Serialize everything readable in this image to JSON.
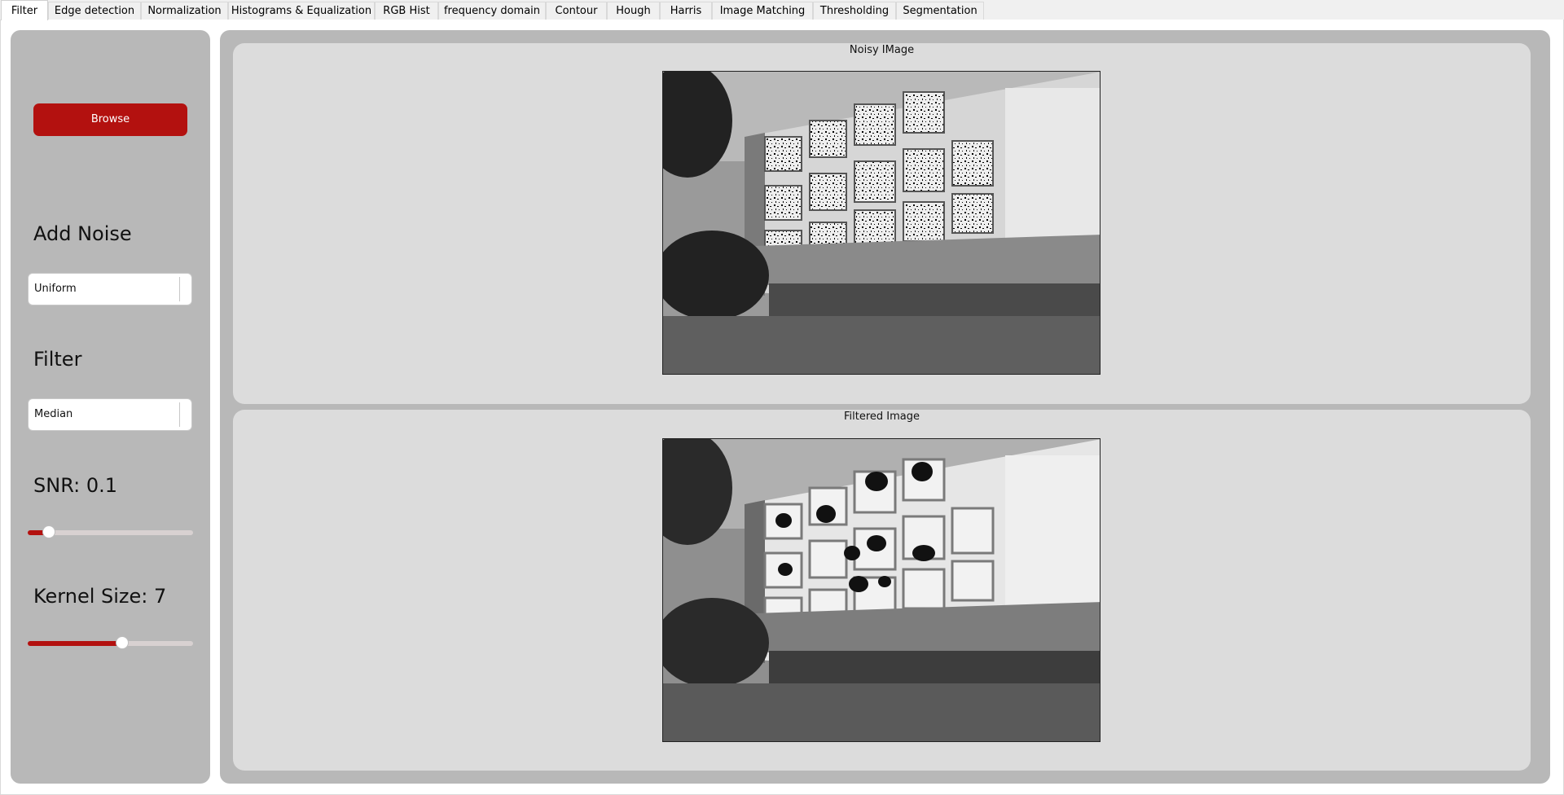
{
  "tabs": [
    {
      "label": "Filter",
      "active": true
    },
    {
      "label": "Edge detection"
    },
    {
      "label": "Normalization"
    },
    {
      "label": "Histograms & Equalization"
    },
    {
      "label": "RGB Hist"
    },
    {
      "label": "frequency domain"
    },
    {
      "label": "Contour"
    },
    {
      "label": "Hough"
    },
    {
      "label": "Harris"
    },
    {
      "label": "Image Matching"
    },
    {
      "label": "Thresholding"
    },
    {
      "label": "Segmentation"
    }
  ],
  "sidebar": {
    "browse_label": "Browse",
    "noise_title": "Add Noise",
    "noise_value": "Uniform",
    "filter_title": "Filter",
    "filter_value": "Median",
    "snr_label": "SNR: 0.1",
    "snr_fraction": 0.13,
    "kernel_label": "Kernel Size: 7",
    "kernel_fraction": 0.57
  },
  "panels": {
    "noisy_title": "Noisy IMage",
    "filtered_title": "Filtered Image"
  },
  "colors": {
    "accent": "#b3110f",
    "panel_bg": "#b8b8b8",
    "inner_bg": "#dcdcdc"
  }
}
